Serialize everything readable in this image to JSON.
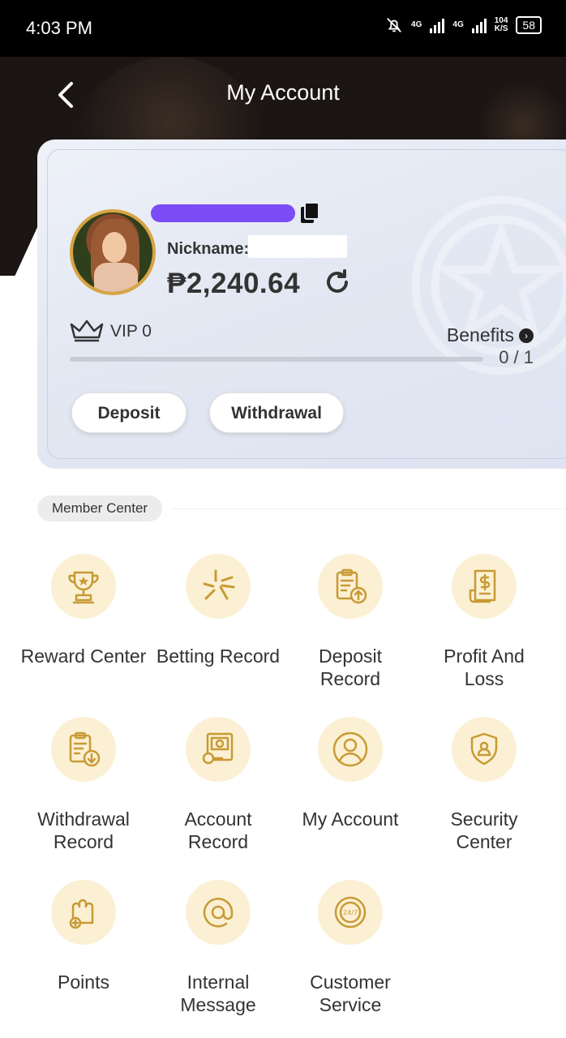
{
  "status_bar": {
    "time": "4:03 PM",
    "network_1": "4G",
    "network_2": "4G",
    "speed_value": "104",
    "speed_unit": "K/S",
    "battery": "58"
  },
  "header": {
    "title": "My Account"
  },
  "profile": {
    "nickname_label": "Nickname:",
    "balance": "₱2,240.64",
    "vip_label": "VIP 0",
    "benefits_label": "Benefits",
    "progress_text": "0 / 1",
    "progress_fraction": 0.0,
    "deposit_label": "Deposit",
    "withdrawal_label": "Withdrawal"
  },
  "member_center": {
    "title": "Member Center",
    "items": [
      {
        "label": "Reward Center",
        "icon": "trophy-icon"
      },
      {
        "label": "Betting Record",
        "icon": "sparkle-icon"
      },
      {
        "label": "Deposit Record",
        "icon": "deposit-clipboard-icon"
      },
      {
        "label": "Profit And Loss",
        "icon": "receipt-dollar-icon"
      },
      {
        "label": "Withdrawal Record",
        "icon": "withdrawal-clipboard-icon"
      },
      {
        "label": "Account Record",
        "icon": "account-record-icon"
      },
      {
        "label": "My Account",
        "icon": "user-circle-icon"
      },
      {
        "label": "Security Center",
        "icon": "shield-user-icon"
      },
      {
        "label": "Points",
        "icon": "points-icon"
      },
      {
        "label": "Internal Message",
        "icon": "at-sign-icon"
      },
      {
        "label": "Customer Service",
        "icon": "support-24-7-icon"
      }
    ]
  },
  "colors": {
    "accent_gold": "#d8a443",
    "icon_bg": "#fbf0d3",
    "header_bg": "#1b1614",
    "redact_purple": "#7b4cf6"
  }
}
